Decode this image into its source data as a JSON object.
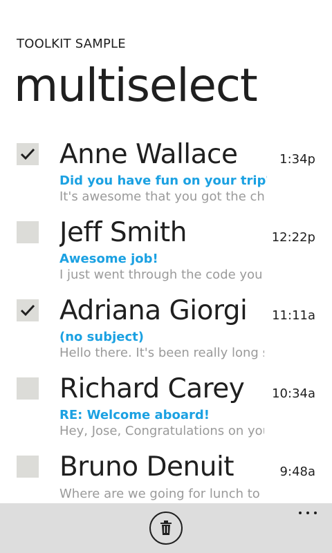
{
  "header": {
    "app_title": "TOOLKIT SAMPLE",
    "page_title": "multiselect"
  },
  "messages": [
    {
      "sender": "Anne Wallace",
      "time": "1:34p",
      "subject": "Did you have fun on your trip?",
      "preview": "It's awesome that you got the cha",
      "checked": true
    },
    {
      "sender": "Jeff Smith",
      "time": "12:22p",
      "subject": "Awesome job!",
      "preview": "I just went through the code you s",
      "checked": false
    },
    {
      "sender": "Adriana Giorgi",
      "time": "11:11a",
      "subject": "(no subject)",
      "preview": "Hello there. It's been really long si",
      "checked": true
    },
    {
      "sender": "Richard Carey",
      "time": "10:34a",
      "subject": "RE: Welcome aboard!",
      "preview": "Hey, Jose, Congratulations on you",
      "checked": false
    },
    {
      "sender": "Bruno Denuit",
      "time": "9:48a",
      "subject": "",
      "preview": "Where are we going for lunch to",
      "checked": false
    }
  ],
  "app_bar": {
    "delete_icon": "trash-icon",
    "more_icon": "ellipsis-icon"
  },
  "colors": {
    "accent": "#1ba1e2",
    "app_bar": "#dddddd",
    "checkbox": "#dcdcd8",
    "preview_text": "#9a9a9a"
  }
}
